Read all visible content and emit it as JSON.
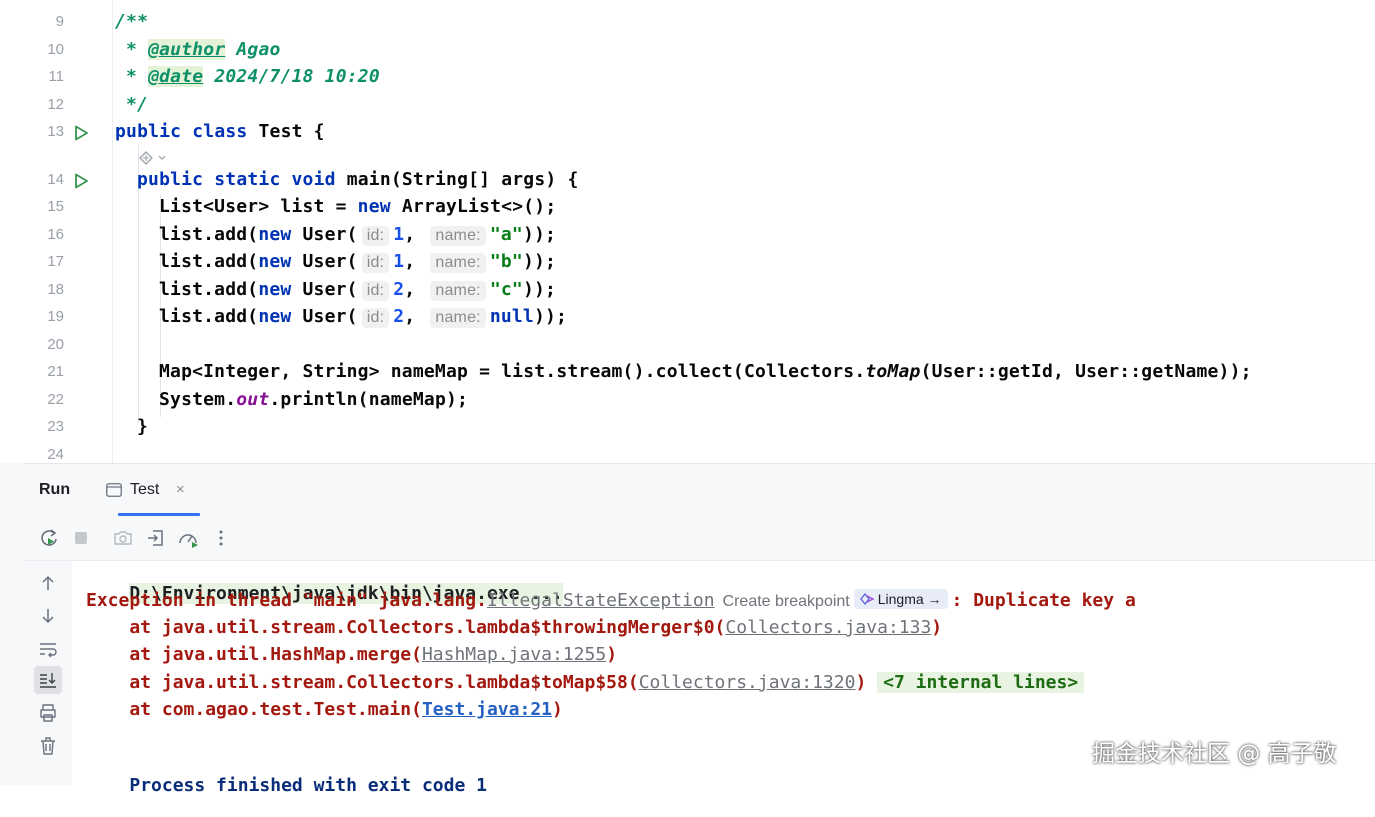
{
  "editor": {
    "lines": [
      {
        "num": "9",
        "text": "/**"
      },
      {
        "num": "10",
        "tag": "@author",
        "rest": " Agao"
      },
      {
        "num": "11",
        "tag": "@date",
        "rest": " 2024/7/18 10:20"
      },
      {
        "num": "12",
        "text": "*/"
      },
      {
        "num": "13",
        "kw": "public class",
        "rest": " Test {"
      },
      {
        "num": "14",
        "kw": "public static void",
        "rest": " main(String[] args) {"
      },
      {
        "num": "15",
        "a": "List<User> list = ",
        "kw": "new",
        "b": " ArrayList<>();"
      },
      {
        "num": "16",
        "arg1": "1",
        "arg2": "\"a\""
      },
      {
        "num": "17",
        "arg1": "1",
        "arg2": "\"b\""
      },
      {
        "num": "18",
        "arg1": "2",
        "arg2": "\"c\""
      },
      {
        "num": "19",
        "arg1": "2",
        "arg2": "null"
      },
      {
        "num": "20"
      },
      {
        "num": "21",
        "a": "Map<Integer, String> nameMap = list.stream().collect(Collectors.",
        "method": "toMap",
        "b": "(User::getId, User::getName));"
      },
      {
        "num": "22",
        "a": "System.",
        "field": "out",
        "b": ".println(nameMap);"
      },
      {
        "num": "23",
        "text": "}"
      },
      {
        "num": "24"
      }
    ],
    "comment_star": "*",
    "add_prefix": "list.add(",
    "add_new": "new",
    "add_user": " User(",
    "hint_id": "id:",
    "hint_name": "name:",
    "comma": ",",
    "add_suffix": "));"
  },
  "run_panel": {
    "title": "Run",
    "tab_label": "Test",
    "tab_close": "×"
  },
  "console": {
    "cmd": "D:\\Environment\\java\\jdk\\bin\\java.exe ...",
    "exc_prefix": "Exception in thread \"main\" java.lang.",
    "exc_class": "IllegalStateException",
    "breakpoint": "Create breakpoint",
    "lingma": "Lingma →",
    "exc_msg": ": Duplicate key a",
    "stack": [
      {
        "pre": "    at java.util.stream.Collectors.lambda$throwingMerger$0(",
        "link": "Collectors.java:133",
        "post": ")"
      },
      {
        "pre": "    at java.util.HashMap.merge(",
        "link": "HashMap.java:1255",
        "post": ")"
      },
      {
        "pre": "    at java.util.stream.Collectors.lambda$toMap$58(",
        "link": "Collectors.java:1320",
        "post": ")",
        "extra": "<7 internal lines>"
      },
      {
        "pre": "    at com.agao.test.Test.main(",
        "link": "Test.java:21",
        "post": ")"
      }
    ],
    "exit": "Process finished with exit code 1"
  },
  "watermark": "掘金技术社区 @ 高子敬",
  "colors": {
    "keyword": "#0033b3",
    "comment": "#0d8f68",
    "string": "#067d17",
    "number": "#1750eb",
    "error": "#a4190f",
    "accent": "#3574f0"
  }
}
